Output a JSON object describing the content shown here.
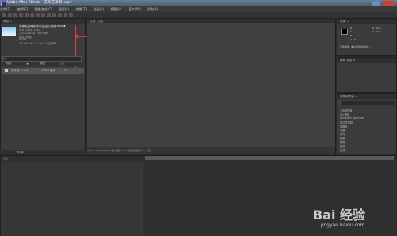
{
  "window": {
    "title": "Adobe After Effects - 未命名项目.aep*"
  },
  "menu": [
    "文件(F)",
    "编辑(E)",
    "图像合成(C)",
    "图层(L)",
    "效果(T)",
    "动画(A)",
    "视图(V)",
    "窗口(W)",
    "帮助(H)"
  ],
  "project": {
    "tab": "项目 ×",
    "file_name": "未命名剪辑的手机生活小视频.mp4▼",
    "info_lines": [
      "576 x 864 (1.00)",
      "△0;00;18;26, 29.97 fps",
      "数百万颜色",
      "H.264",
      "44.100 kHz / 32 bit U / 立体声"
    ],
    "search_placeholder": "ρ▾",
    "columns": [
      "名称",
      "▲",
      "类型",
      "大小"
    ],
    "row": {
      "name": "未命名...mp4",
      "type": "MPEG 影片",
      "size": "7..."
    },
    "bottom": "8 bpc"
  },
  "comp": {
    "tab": "合成：(无)",
    "footer": "50% ▾ ⊞ 0;00;00;00 ◉ (完整) ▾ ⊡ ⊟ 活动摄像机 ▾ 1个视 ▾"
  },
  "info_panel": {
    "tab": "信息 ×",
    "r": "R :",
    "g": "G :",
    "b": "B :",
    "a": "A : 0",
    "x": "X : 216",
    "y": "Y : 122",
    "status": "已用存储：未命名剪辑的手机..."
  },
  "audio_panel": {
    "tab": "音频 预览 ×"
  },
  "effects_panel": {
    "tab": "效果和预设 ×",
    "items": [
      "* 动画预置",
      "3D 通道",
      "Synthetic Aperture",
      "表达式控制",
      "风格化",
      "过渡",
      "过时",
      "抠像",
      "模糊",
      "扭曲",
      "生成"
    ]
  },
  "timeline": {
    "tab": "(无)"
  },
  "watermark": {
    "text": "Bai 经验",
    "url": "jingyan.baidu.com"
  }
}
